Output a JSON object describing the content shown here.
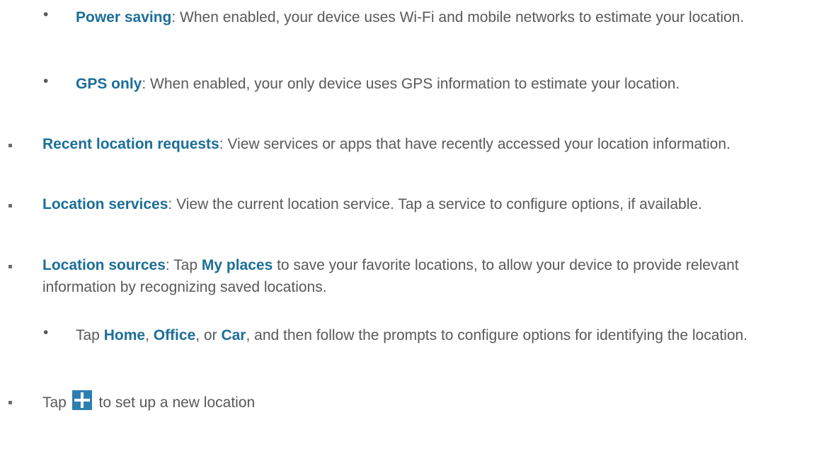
{
  "items": [
    {
      "level": "sub",
      "bold": "Power saving",
      "rest": ": When enabled, your device uses Wi-Fi and mobile networks to estimate your location."
    },
    {
      "level": "sub",
      "bold": "GPS only",
      "rest": ": When enabled, your only device uses GPS information to estimate your location."
    },
    {
      "level": "top",
      "bold": "Recent location requests",
      "rest": ": View services or apps that have recently accessed your location information."
    },
    {
      "level": "top",
      "bold": "Location services",
      "rest": ": View the current location service. Tap a service to configure options, if available."
    },
    {
      "level": "top",
      "bold": "Location sources",
      "rest_1": ": Tap ",
      "bold_2": "My places",
      "rest_2": " to save your favorite locations, to allow your device to provide relevant information by recognizing saved locations."
    },
    {
      "level": "sub",
      "t1": "Tap ",
      "b1": "Home",
      "t2": ", ",
      "b2": "Office",
      "t3": ", or ",
      "b3": "Car",
      "t4": ", and then follow the prompts to configure options for identifying the location."
    },
    {
      "level": "top",
      "before_icon": "Tap",
      "icon": "plus-icon",
      "after_icon": "to set up a new location"
    }
  ],
  "colors": {
    "text": "#58595b",
    "bold": "#1b6e98",
    "icon_bg": "#2d7fb0"
  }
}
